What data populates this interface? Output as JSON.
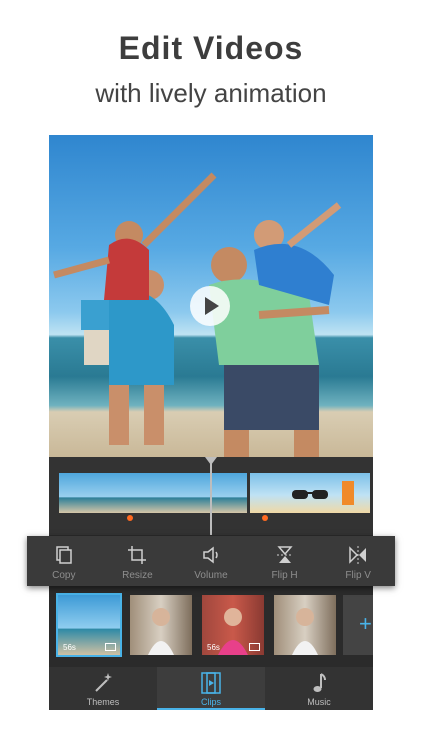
{
  "headline": {
    "title": "Edit Videos",
    "subtitle": "with lively animation"
  },
  "toolbar": {
    "items": [
      {
        "label": "Copy",
        "icon": "copy-icon"
      },
      {
        "label": "Resize",
        "icon": "crop-icon"
      },
      {
        "label": "Volume",
        "icon": "volume-icon"
      },
      {
        "label": "Flip H",
        "icon": "flip-horizontal-icon"
      },
      {
        "label": "Flip V",
        "icon": "flip-vertical-icon"
      }
    ]
  },
  "clips": [
    {
      "duration": "56s",
      "type": "video",
      "selected": true
    },
    {
      "duration": "",
      "type": "photo",
      "selected": false
    },
    {
      "duration": "56s",
      "type": "video",
      "selected": false
    },
    {
      "duration": "",
      "type": "photo",
      "selected": false
    }
  ],
  "tabs": [
    {
      "label": "Themes",
      "icon": "magic-wand-icon",
      "active": false
    },
    {
      "label": "Clips",
      "icon": "film-icon",
      "active": true
    },
    {
      "label": "Music",
      "icon": "music-note-icon",
      "active": false
    }
  ],
  "colors": {
    "accent": "#49b3e8",
    "marker": "#ff6a21",
    "panel": "#2b2b2b"
  }
}
